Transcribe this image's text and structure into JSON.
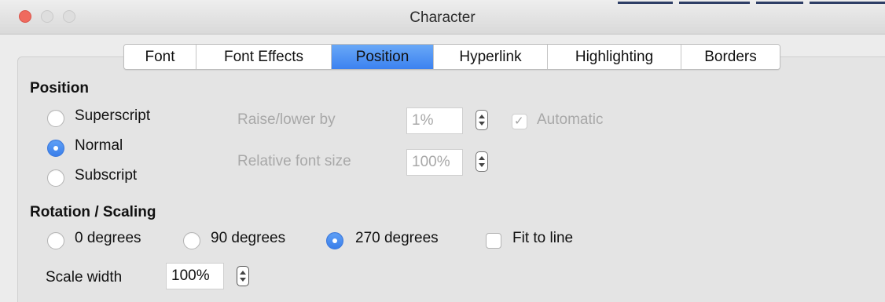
{
  "window": {
    "title": "Character"
  },
  "tabs": [
    {
      "label": "Font"
    },
    {
      "label": "Font Effects"
    },
    {
      "label": "Position"
    },
    {
      "label": "Hyperlink"
    },
    {
      "label": "Highlighting"
    },
    {
      "label": "Borders"
    }
  ],
  "active_tab": "Position",
  "position": {
    "heading": "Position",
    "options": [
      "Superscript",
      "Normal",
      "Subscript"
    ],
    "selected": "Normal",
    "raise_lower_label": "Raise/lower by",
    "raise_lower_value": "1%",
    "automatic_label": "Automatic",
    "automatic_checked": true,
    "relative_size_label": "Relative font size",
    "relative_size_value": "100%"
  },
  "rotation": {
    "heading": "Rotation / Scaling",
    "options": [
      "0 degrees",
      "90 degrees",
      "270 degrees"
    ],
    "selected": "270 degrees",
    "fit_to_line_label": "Fit to line",
    "fit_to_line_checked": false,
    "scale_width_label": "Scale width",
    "scale_width_value": "100%"
  },
  "colors": {
    "accent": "#3c82f0",
    "close_button": "#ef6a5e",
    "disabled_text": "#a8a8a8"
  }
}
